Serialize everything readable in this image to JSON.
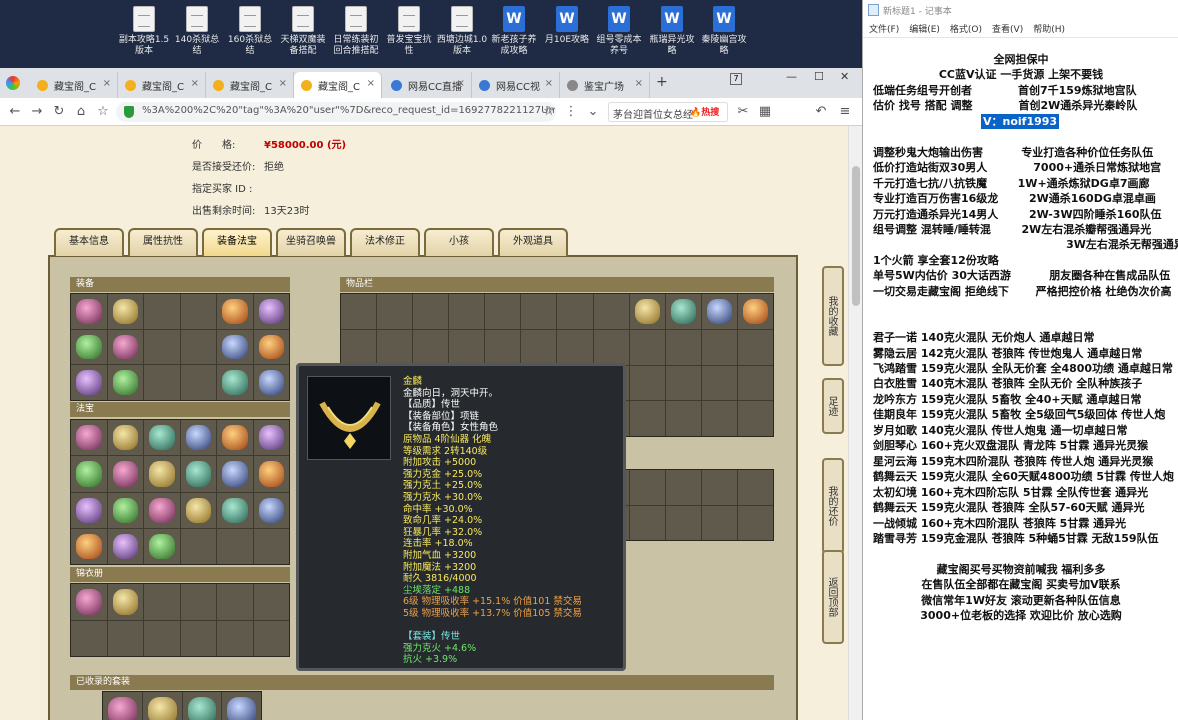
{
  "desktop": {
    "icons": [
      {
        "label": "副本攻略1.5版本",
        "type": "doc"
      },
      {
        "label": "140杀狱总结",
        "type": "doc"
      },
      {
        "label": "160杀狱总结",
        "type": "doc"
      },
      {
        "label": "天梯双魔装备搭配",
        "type": "doc"
      },
      {
        "label": "日常练装初回合推搭配",
        "type": "doc"
      },
      {
        "label": "普发宝宝抗性",
        "type": "doc"
      },
      {
        "label": "西塘边城1.0版本",
        "type": "doc"
      },
      {
        "label": "新老孩子养成攻略",
        "type": "word"
      },
      {
        "label": "月10E攻略",
        "type": "word"
      },
      {
        "label": "组号零成本养号",
        "type": "word"
      },
      {
        "label": "瓶瑞异光攻略",
        "type": "word"
      },
      {
        "label": "秦陵幽宫攻略",
        "type": "word"
      }
    ]
  },
  "browser": {
    "tabs": [
      {
        "label": "藏宝阁_C",
        "color": "#f2b01e"
      },
      {
        "label": "藏宝阁_C",
        "color": "#f2b01e"
      },
      {
        "label": "藏宝阁_C",
        "color": "#f2b01e"
      },
      {
        "label": "藏宝阁_C",
        "color": "#f2b01e"
      },
      {
        "label": "网易CC直播",
        "color": "#3a78d6"
      },
      {
        "label": "网易CC视",
        "color": "#3a78d6"
      },
      {
        "label": "鉴宝广场",
        "color": "#888888"
      }
    ],
    "url": "%3A%200%2C%20\"tag\"%3A%20\"user\"%7D&reco_request_id=1692778221127Umlkw",
    "search_text": "茅台迎首位女总经",
    "hot_label": "热搜"
  },
  "listing": {
    "price_label": "价　　格:",
    "price_value": "¥58000.00 (元)",
    "bargain_label": "是否接受还价:",
    "bargain_value": "拒绝",
    "buyer_label": "指定买家 ID :",
    "buyer_value": "",
    "remain_label": "出售剩余时间:",
    "remain_value": "13天23时"
  },
  "page_tabs": [
    "基本信息",
    "属性抗性",
    "装备法宝",
    "坐骑召唤兽",
    "法术修正",
    "小孩",
    "外观道具"
  ],
  "panel": {
    "equip_title": "装备",
    "fabao_title": "法宝",
    "jinyi_title": "锦衣册",
    "bag_title": "物品栏",
    "suit_title": "已收录的套装"
  },
  "tooltip": {
    "name": "金麟",
    "lines": [
      {
        "text": "金麟向日，洞天中开。",
        "color": "white"
      },
      {
        "text": "【品质】传世",
        "color": "white"
      },
      {
        "text": "【装备部位】项链",
        "color": "white"
      },
      {
        "text": "【装备角色】女性角色",
        "color": "white"
      },
      {
        "text": "原物品 4阶仙器 化魄",
        "color": "yellow"
      },
      {
        "text": "等级需求 2转140级",
        "color": "yellow"
      },
      {
        "text": "附加攻击 +5000",
        "color": "yellow"
      },
      {
        "text": "强力克金 +25.0%",
        "color": "yellow"
      },
      {
        "text": "强力克土 +25.0%",
        "color": "yellow"
      },
      {
        "text": "强力克水 +30.0%",
        "color": "yellow"
      },
      {
        "text": "命中率 +30.0%",
        "color": "yellow"
      },
      {
        "text": "致命几率 +24.0%",
        "color": "yellow"
      },
      {
        "text": "狂暴几率 +32.0%",
        "color": "yellow"
      },
      {
        "text": "连击率 +18.0%",
        "color": "yellow"
      },
      {
        "text": "附加气血 +3200",
        "color": "yellow"
      },
      {
        "text": "附加魔法 +3200",
        "color": "yellow"
      },
      {
        "text": "耐久 3816/4000",
        "color": "yellow"
      },
      {
        "text": "尘埃落定 +488",
        "color": "green"
      },
      {
        "text": "6级 物理吸收率 +15.1% 价值101 禁交易",
        "color": "orange"
      },
      {
        "text": "5级 物理吸收率 +13.7% 价值105 禁交易",
        "color": "orange"
      },
      {
        "text": "",
        "color": "white"
      },
      {
        "text": "【套装】传世",
        "color": "cyan"
      },
      {
        "text": "强力克火 +4.6%",
        "color": "green"
      },
      {
        "text": "抗火 +3.9%",
        "color": "green"
      }
    ]
  },
  "side_buttons": [
    "我的收藏",
    "足迹",
    "我的还价",
    "返回顶部"
  ],
  "notepad": {
    "title": "新标题1 - 记事本",
    "menu": [
      "文件(F)",
      "编辑(E)",
      "格式(O)",
      "查看(V)",
      "帮助(H)"
    ],
    "lines": [
      "全网担保中",
      "CC蓝V认证 一手货源 上架不要钱",
      "低端任务组号开创者            首创7千159炼狱地宫队",
      "估价 找号 搭配 调整            首创2W通杀异光秦岭队",
      "V：noif1993",
      "",
      "调整秒鬼大炮输出伤害          专业打造各种价位任务队伍",
      "低价打造站街双30男人            7000+通杀日常炼狱地宫",
      "千元打造七抗/八抗铁魔        1W+通杀炼狱DG卓7画廊",
      "专业打造百万伤害16级龙        2W通杀160DG卓混卓画",
      "万元打造通杀异光14男人        2W-3W四阶睡杀160队伍",
      "组号调整 混转睡/睡转混        2W左右混杀瓣帮强通异光",
      "                                                    3W左右混杀无帮强通异光",
      "1个火箭 享全套12份攻略",
      "单号5W内估价 30大话西游          朋友圈各种在售成品队伍",
      "一切交易走藏宝阁 拒绝线下       严格把控价格 杜绝伪次价高",
      "",
      "",
      "君子一诺 140克火混队 无价炮人 通卓越日常",
      "雾隐云居 142克火混队 苍狼阵 传世炮鬼人 通卓越日常",
      "飞鸿踏雪 159克火混队 全队无价套 全4800功绩 通卓越日常",
      "白衣胜雪 140克木混队 苍狼阵 全队无价 全队种族孩子",
      "龙吟东方 159克火混队 5畜牧 全40+天赋 通卓越日常",
      "佳期良年 159克火混队 5畜牧 全5级回气5级回体 传世人炮",
      "岁月如歌 140克火混队 传世人炮鬼 通一切卓越日常",
      "剑胆琴心 160+克火双盘混队 青龙阵 5甘霖 通异光灵猴",
      "星河云海 159克木四阶混队 苍狼阵 传世人炮 通异光灵猴",
      "鹤舞云天 159克火混队 全60天赋4800功绩 5甘霖 传世人炮",
      "太初幻境 160+克木四阶忘队 5甘霖 全队传世套 通异光",
      "鹤舞云天 159克火混队 苍狼阵 全队57-60天赋 通异光",
      "一战倾城 160+克木四阶混队 苍狼阵 5甘霖 通异光",
      "踏雪寻芳 159克金混队 苍狼阵 5种蛹5甘霖 无敌159队伍",
      "",
      "藏宝阁买号买物资前喊我 福利多多",
      "在售队伍全部都在藏宝阁 买卖号加V联系",
      "微信常年1W好友 滚动更新各种队伍信息",
      "3000+位老板的选择 欢迎比价 放心选购"
    ]
  }
}
